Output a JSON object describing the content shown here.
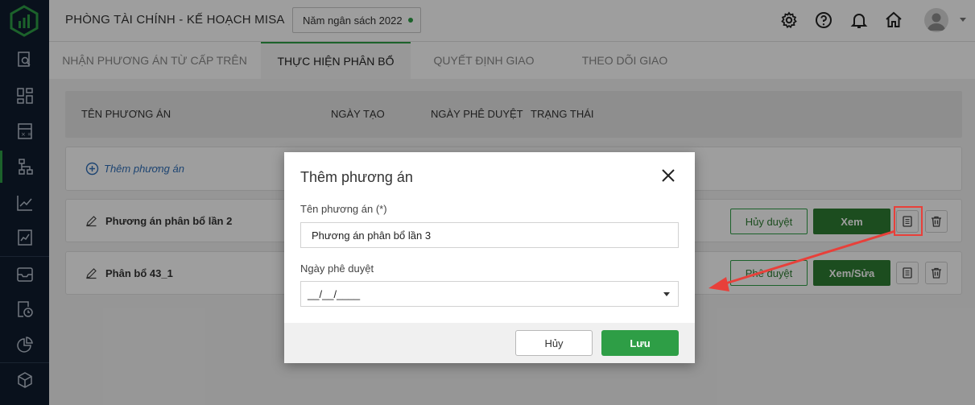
{
  "header": {
    "org_title": "PHÒNG TÀI CHÍNH - KẾ HOẠCH MISA",
    "year_select": "Năm ngân sách 2022"
  },
  "tabs": [
    {
      "label": "NHẬN PHƯƠNG ÁN TỪ CẤP TRÊN"
    },
    {
      "label": "THỰC HIỆN PHÂN BỔ"
    },
    {
      "label": "QUYẾT ĐỊNH GIAO"
    },
    {
      "label": "THEO DÕI GIAO"
    }
  ],
  "table": {
    "columns": [
      "TÊN PHƯƠNG ÁN",
      "NGÀY TẠO",
      "NGÀY PHÊ DUYỆT",
      "TRẠNG THÁI"
    ],
    "add_label": "Thêm phương án",
    "rows": [
      {
        "name": "Phương án phân bổ lần 2",
        "secondary_action": "Hủy duyệt",
        "primary_action": "Xem"
      },
      {
        "name": "Phân bổ 43_1",
        "secondary_action": "Phê duyệt",
        "primary_action": "Xem/Sửa"
      }
    ]
  },
  "modal": {
    "title": "Thêm phương án",
    "name_label": "Tên phương án (*)",
    "name_value": "Phương án phân bổ lần 3",
    "date_label": "Ngày phê duyệt",
    "date_value": "__/__/____",
    "cancel_label": "Hủy",
    "save_label": "Lưu"
  },
  "colors": {
    "sidebar": "#0f1c2e",
    "accent": "#2e9e46",
    "primary_button": "#2e7d32",
    "link": "#2f6fb8",
    "annotation": "#e8403a"
  },
  "icons": {
    "sidebar": [
      "search-doc-icon",
      "dashboard-icon",
      "calculator-icon",
      "hierarchy-icon",
      "line-chart-icon",
      "report-chart-icon",
      "inbox-icon",
      "document-clock-icon",
      "pie-chart-icon",
      "cube-icon"
    ],
    "header": [
      "settings-icon",
      "help-icon",
      "bell-icon",
      "home-icon",
      "avatar"
    ]
  }
}
